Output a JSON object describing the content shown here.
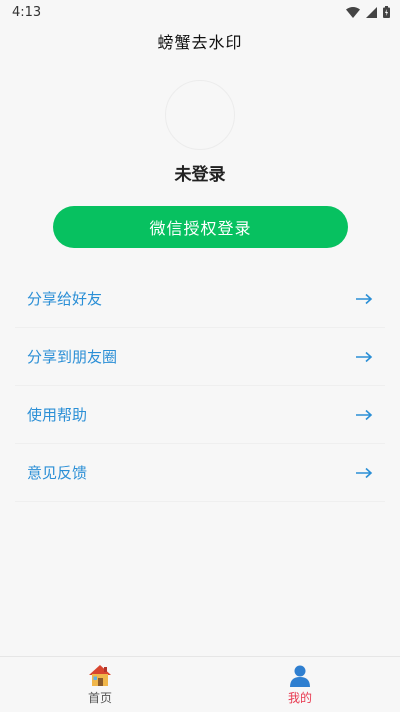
{
  "status_bar": {
    "time": "4:13",
    "icons": [
      "wifi-icon",
      "signal-icon",
      "battery-icon"
    ]
  },
  "header": {
    "title": "螃蟹去水印"
  },
  "profile": {
    "avatar": "avatar-placeholder",
    "username": "未登录",
    "login_button_label": "微信授权登录"
  },
  "menu": {
    "items": [
      {
        "label": "分享给好友",
        "icon": "arrow-right-icon"
      },
      {
        "label": "分享到朋友圈",
        "icon": "arrow-right-icon"
      },
      {
        "label": "使用帮助",
        "icon": "arrow-right-icon"
      },
      {
        "label": "意见反馈",
        "icon": "arrow-right-icon"
      }
    ]
  },
  "tab_bar": {
    "tabs": [
      {
        "label": "首页",
        "icon": "house-icon",
        "active": false
      },
      {
        "label": "我的",
        "icon": "person-icon",
        "active": true
      }
    ]
  },
  "colors": {
    "accent_green": "#07c160",
    "link_blue": "#2b8fd6",
    "active_tab": "#e8384f"
  }
}
